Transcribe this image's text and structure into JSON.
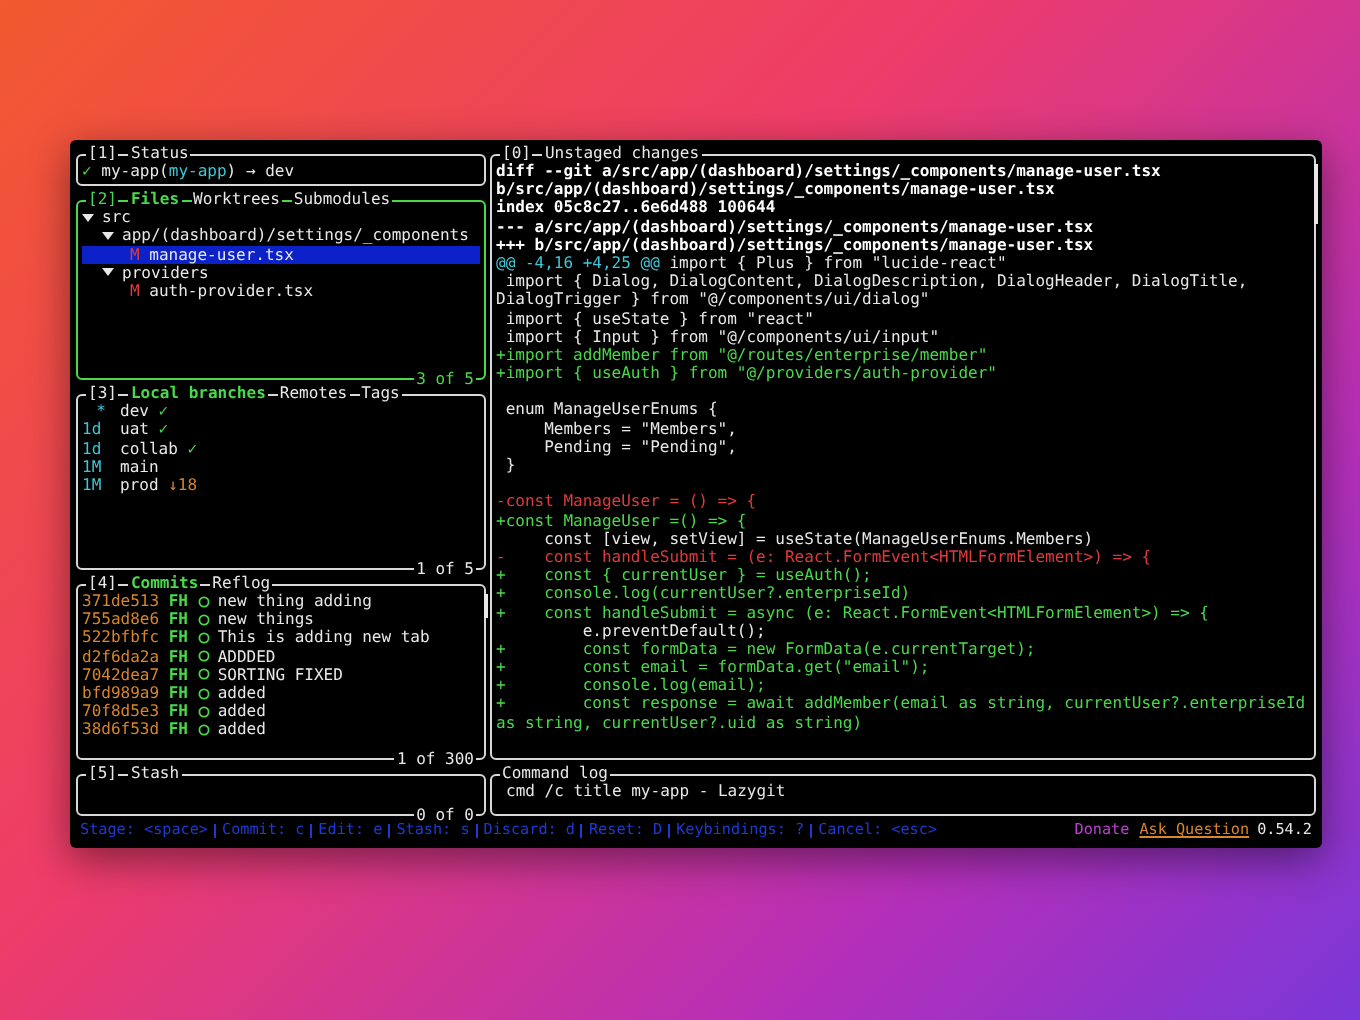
{
  "status": {
    "number": "[1]",
    "tabs": [
      {
        "label": "Status",
        "selected": false
      }
    ],
    "check": "✓",
    "repo": [
      {
        "text": "my-app(",
        "kind": "plain"
      },
      {
        "text": "my-app",
        "kind": "alias"
      },
      {
        "text": ")",
        "kind": "plain"
      }
    ],
    "arrow": "→",
    "branch": "dev"
  },
  "files": {
    "number": "[2]",
    "focused": true,
    "tabs": [
      {
        "label": "Files",
        "selected": true
      },
      {
        "label": "Worktrees",
        "selected": false
      },
      {
        "label": "Submodules",
        "selected": false
      }
    ],
    "footer": "3 of 5",
    "tree": [
      {
        "name": "src",
        "expanded": true,
        "children": [
          {
            "name": "app/(dashboard)/settings/_components",
            "expanded": true,
            "children": [
              {
                "name": "manage-user.tsx",
                "status": "M",
                "selected": true
              }
            ]
          },
          {
            "name": "providers",
            "expanded": true,
            "children": [
              {
                "name": "auth-provider.tsx",
                "status": "M",
                "selected": false
              }
            ]
          }
        ]
      }
    ]
  },
  "branches": {
    "number": "[3]",
    "focused": false,
    "tabs": [
      {
        "label": "Local branches",
        "selected": true
      },
      {
        "label": "Remotes",
        "selected": false
      },
      {
        "label": "Tags",
        "selected": false
      }
    ],
    "footer": "1 of 5",
    "items": [
      {
        "age": "*",
        "name": "dev",
        "status": "✓",
        "kind": "synced"
      },
      {
        "age": "1d",
        "name": "uat",
        "status": "✓",
        "kind": "synced"
      },
      {
        "age": "1d",
        "name": "collab",
        "status": "✓",
        "kind": "synced"
      },
      {
        "age": "1M",
        "name": "main"
      },
      {
        "age": "1M",
        "name": "prod",
        "status": "↓18",
        "kind": "behind"
      }
    ]
  },
  "commits": {
    "number": "[4]",
    "focused": false,
    "tabs": [
      {
        "label": "Commits",
        "selected": true
      },
      {
        "label": "Reflog",
        "selected": false
      }
    ],
    "footer": "1 of 300",
    "items": [
      {
        "hash": "371de513",
        "author": "FH",
        "message": "new thing adding"
      },
      {
        "hash": "755ad8e6",
        "author": "FH",
        "message": "new things"
      },
      {
        "hash": "522bfbfc",
        "author": "FH",
        "message": "This is adding new tab"
      },
      {
        "hash": "d2f6da2a",
        "author": "FH",
        "message": "ADDDED"
      },
      {
        "hash": "7042dea7",
        "author": "FH",
        "message": "SORTING FIXED"
      },
      {
        "hash": "bfd989a9",
        "author": "FH",
        "message": "added"
      },
      {
        "hash": "70f8d5e3",
        "author": "FH",
        "message": "added"
      },
      {
        "hash": "38d6f53d",
        "author": "FH",
        "message": "added"
      }
    ]
  },
  "stash": {
    "number": "[5]",
    "focused": false,
    "tabs": [
      {
        "label": "Stash",
        "selected": false
      }
    ],
    "footer": "0 of 0"
  },
  "diff": {
    "number": "[0]",
    "tabs": [
      {
        "label": "Unstaged changes",
        "selected": false
      }
    ],
    "lines": [
      {
        "kind": "header",
        "text": "diff --git a/src/app/(dashboard)/settings/_components/manage-user.tsx"
      },
      {
        "kind": "header",
        "text": "b/src/app/(dashboard)/settings/_components/manage-user.tsx"
      },
      {
        "kind": "header",
        "text": "index 05c8c27..6e6d488 100644"
      },
      {
        "kind": "header",
        "text": "--- a/src/app/(dashboard)/settings/_components/manage-user.tsx"
      },
      {
        "kind": "header",
        "text": "+++ b/src/app/(dashboard)/settings/_components/manage-user.tsx"
      },
      {
        "kind": "hunk",
        "hunk": "@@ -4,16 +4,25 @@",
        "text": " import { Plus } from \"lucide-react\""
      },
      {
        "kind": "context",
        "text": " import { Dialog, DialogContent, DialogDescription, DialogHeader, DialogTitle,"
      },
      {
        "kind": "context",
        "text": "DialogTrigger } from \"@/components/ui/dialog\""
      },
      {
        "kind": "context",
        "text": " import { useState } from \"react\""
      },
      {
        "kind": "context",
        "text": " import { Input } from \"@/components/ui/input\""
      },
      {
        "kind": "added",
        "text": "+import addMember from \"@/routes/enterprise/member\""
      },
      {
        "kind": "added",
        "text": "+import { useAuth } from \"@/providers/auth-provider\""
      },
      {
        "kind": "blank"
      },
      {
        "kind": "context",
        "text": " enum ManageUserEnums {"
      },
      {
        "kind": "context",
        "text": "     Members = \"Members\","
      },
      {
        "kind": "context",
        "text": "     Pending = \"Pending\","
      },
      {
        "kind": "context",
        "text": " }"
      },
      {
        "kind": "blank"
      },
      {
        "kind": "removed",
        "text": "-const ManageUser = () => {"
      },
      {
        "kind": "added",
        "text": "+const ManageUser =() => {"
      },
      {
        "kind": "context",
        "text": "     const [view, setView] = useState(ManageUserEnums.Members)"
      },
      {
        "kind": "removed",
        "text": "-    const handleSubmit = (e: React.FormEvent<HTMLFormElement>) => {"
      },
      {
        "kind": "added",
        "text": "+    const { currentUser } = useAuth();"
      },
      {
        "kind": "added",
        "text": "+    console.log(currentUser?.enterpriseId)"
      },
      {
        "kind": "added",
        "text": "+    const handleSubmit = async (e: React.FormEvent<HTMLFormElement>) => {"
      },
      {
        "kind": "context",
        "text": "         e.preventDefault();"
      },
      {
        "kind": "added",
        "text": "+        const formData = new FormData(e.currentTarget);"
      },
      {
        "kind": "added",
        "text": "+        const email = formData.get(\"email\");"
      },
      {
        "kind": "added",
        "text": "+        console.log(email);"
      },
      {
        "kind": "added",
        "text": "+        const response = await addMember(email as string, currentUser?.enterpriseId"
      },
      {
        "kind": "added",
        "text": "as string, currentUser?.uid as string)"
      }
    ]
  },
  "command_log": {
    "title": "Command log",
    "lines": [
      "cmd /c title my-app - Lazygit"
    ]
  },
  "keybindings": [
    "Stage: <space>",
    "Commit: c",
    "Edit: e",
    "Stash: s",
    "Discard: d",
    "Reset: D",
    "Keybindings: ?",
    "Cancel: <esc>"
  ],
  "links": [
    {
      "label": "Donate",
      "kind": "donate"
    },
    {
      "label": "Ask Question",
      "kind": "ask"
    }
  ],
  "version": "0.54.2"
}
